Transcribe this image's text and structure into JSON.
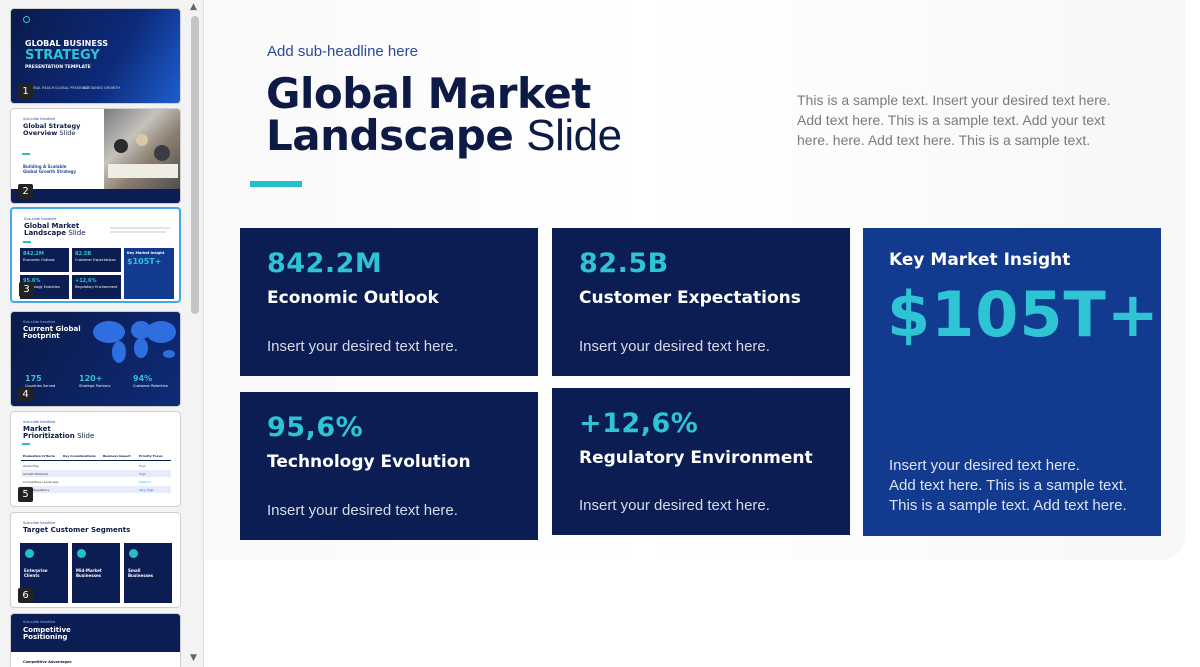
{
  "slides": [
    {
      "number": "1",
      "title_line1": "GLOBAL BUSINESS",
      "title_line2": "STRATEGY",
      "subtitle": "PRESENTATION TEMPLATE",
      "stat_labels": [
        "GLOBAL REACH",
        "GLOBAL PRESENCE",
        "SUSTAINED GROWTH"
      ]
    },
    {
      "number": "2",
      "eyebrow": "Sub-slide headline",
      "title_line1": "Global Strategy",
      "title_line2": "Overview",
      "title_suffix": "Slide",
      "tagline_line1": "Building A Scalable",
      "tagline_line2": "Global Growth Strategy"
    },
    {
      "number": "3",
      "eyebrow": "Sub-slide headline",
      "title_line1": "Global Market",
      "title_line2": "Landscape",
      "title_suffix": "Slide",
      "cells": [
        {
          "value": "842.2M",
          "label": "Economic Outlook"
        },
        {
          "value": "82.5B",
          "label": "Customer Expectations"
        },
        {
          "value": "95,6%",
          "label": "Technology Evolution"
        },
        {
          "value": "+12,6%",
          "label": "Regulatory Environment"
        }
      ],
      "insight_title": "Key Market Insight",
      "insight_value": "$105T+"
    },
    {
      "number": "4",
      "eyebrow": "Sub-slide headline",
      "title_line1": "Current Global",
      "title_line2": "Footprint",
      "stats": [
        {
          "value": "175",
          "label": "Countries Served"
        },
        {
          "value": "120+",
          "label": "Strategic Partners"
        },
        {
          "value": "94%",
          "label": "Customer Retention"
        }
      ]
    },
    {
      "number": "5",
      "eyebrow": "Sub-slide headline",
      "title_line1": "Market",
      "title_line2": "Prioritization",
      "title_suffix": "Slide",
      "columns": [
        "Evaluation Criteria",
        "Key Considerations",
        "Business Impact",
        "Priority Focus"
      ],
      "rows": [
        "Global Exp",
        "Growth Potential",
        "Competitive Landscape",
        "Regulatory"
      ],
      "priorities": [
        "High",
        "High",
        "Medium",
        "Very High"
      ]
    },
    {
      "number": "6",
      "eyebrow": "Sub-slide headline",
      "title": "Target Customer Segments",
      "segments": [
        {
          "line1": "Enterprise",
          "line2": "Clients"
        },
        {
          "line1": "Mid-Market",
          "line2": "Businesses"
        },
        {
          "line1": "Small",
          "line2": "Businesses"
        }
      ]
    },
    {
      "number": "7",
      "eyebrow": "Sub-slide headline",
      "title_line1": "Competitive",
      "title_line2": "Positioning",
      "footer": "Competitive Advantages"
    }
  ],
  "main": {
    "sub_headline": "Add sub-headline here",
    "title_bold_1": "Global Market",
    "title_bold_2": "Landscape",
    "title_light": "Slide",
    "intro_line1": "This is a sample text. Insert your desired text here.",
    "intro_line2": "Add text here. This is a sample text. Add your text",
    "intro_line3": "here. here. Add text here. This is a sample text.",
    "cards": [
      {
        "value": "842.2M",
        "label": "Economic Outlook",
        "text": "Insert your desired text here."
      },
      {
        "value": "82.5B",
        "label": "Customer Expectations",
        "text": "Insert your desired text here."
      },
      {
        "value": "95,6%",
        "label": "Technology Evolution",
        "text": "Insert your desired text here."
      },
      {
        "value": "+12,6%",
        "label": "Regulatory Environment",
        "text": "Insert your desired text here."
      }
    ],
    "insight": {
      "title": "Key Market Insight",
      "value": "$105T+",
      "text_line1": "Insert your desired text here.",
      "text_line2": "Add text here. This is a sample text.",
      "text_line3": "This is a sample text. Add text here."
    }
  },
  "colors": {
    "navy": "#0b1d52",
    "royal_blue": "#123a8f",
    "teal_accent": "#21c0cb",
    "selection_blue": "#3fa9e7"
  },
  "icons": {
    "scroll_up": "▲",
    "scroll_down": "▼"
  }
}
